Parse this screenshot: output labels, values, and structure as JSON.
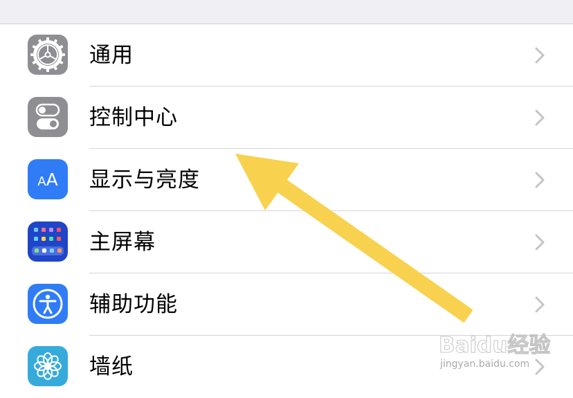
{
  "settings": {
    "items": [
      {
        "label": "通用",
        "icon": "gear-icon",
        "icon_bg": "#8e8e93"
      },
      {
        "label": "控制中心",
        "icon": "toggles-icon",
        "icon_bg": "#8e8e93"
      },
      {
        "label": "显示与亮度",
        "icon": "text-size-icon",
        "icon_bg": "#2f7cf6",
        "icon_text": "AA"
      },
      {
        "label": "主屏幕",
        "icon": "home-screen-grid-icon",
        "icon_bg": "#1f45c8"
      },
      {
        "label": "辅助功能",
        "icon": "accessibility-icon",
        "icon_bg": "#2f7cf6"
      },
      {
        "label": "墙纸",
        "icon": "wallpaper-flower-icon",
        "icon_bg": "#37aadc"
      }
    ]
  },
  "annotation": {
    "arrow_color": "#f8d24f"
  },
  "watermark": {
    "logo": "Baidu经验",
    "url": "jingyan.baidu.com"
  }
}
